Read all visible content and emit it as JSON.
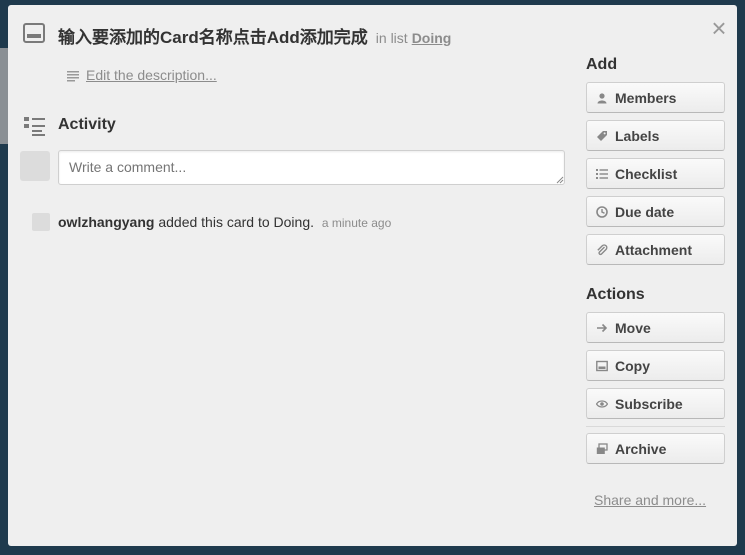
{
  "card": {
    "title": "输入要添加的Card名称点击Add添加完成",
    "in_list_prefix": "in list",
    "list_name": "Doing",
    "description_link": "Edit the description..."
  },
  "activity": {
    "heading": "Activity",
    "comment_placeholder": "Write a comment...",
    "entries": [
      {
        "member": "owlzhangyang",
        "text": "added this card to Doing.",
        "time": "a minute ago"
      }
    ]
  },
  "sidebar": {
    "add_heading": "Add",
    "add_buttons": [
      {
        "label": "Members",
        "icon": "person-icon"
      },
      {
        "label": "Labels",
        "icon": "tag-icon"
      },
      {
        "label": "Checklist",
        "icon": "checklist-icon"
      },
      {
        "label": "Due date",
        "icon": "clock-icon"
      },
      {
        "label": "Attachment",
        "icon": "paperclip-icon"
      }
    ],
    "actions_heading": "Actions",
    "action_buttons": [
      {
        "label": "Move",
        "icon": "arrow-right-icon"
      },
      {
        "label": "Copy",
        "icon": "card-icon"
      },
      {
        "label": "Subscribe",
        "icon": "eye-icon"
      },
      {
        "label": "Archive",
        "icon": "archive-icon"
      }
    ],
    "share_link": "Share and more..."
  },
  "colors": {
    "backdrop": "#1f3a4d",
    "dialog_bg": "#efefef",
    "muted_text": "#8c8c8c"
  }
}
